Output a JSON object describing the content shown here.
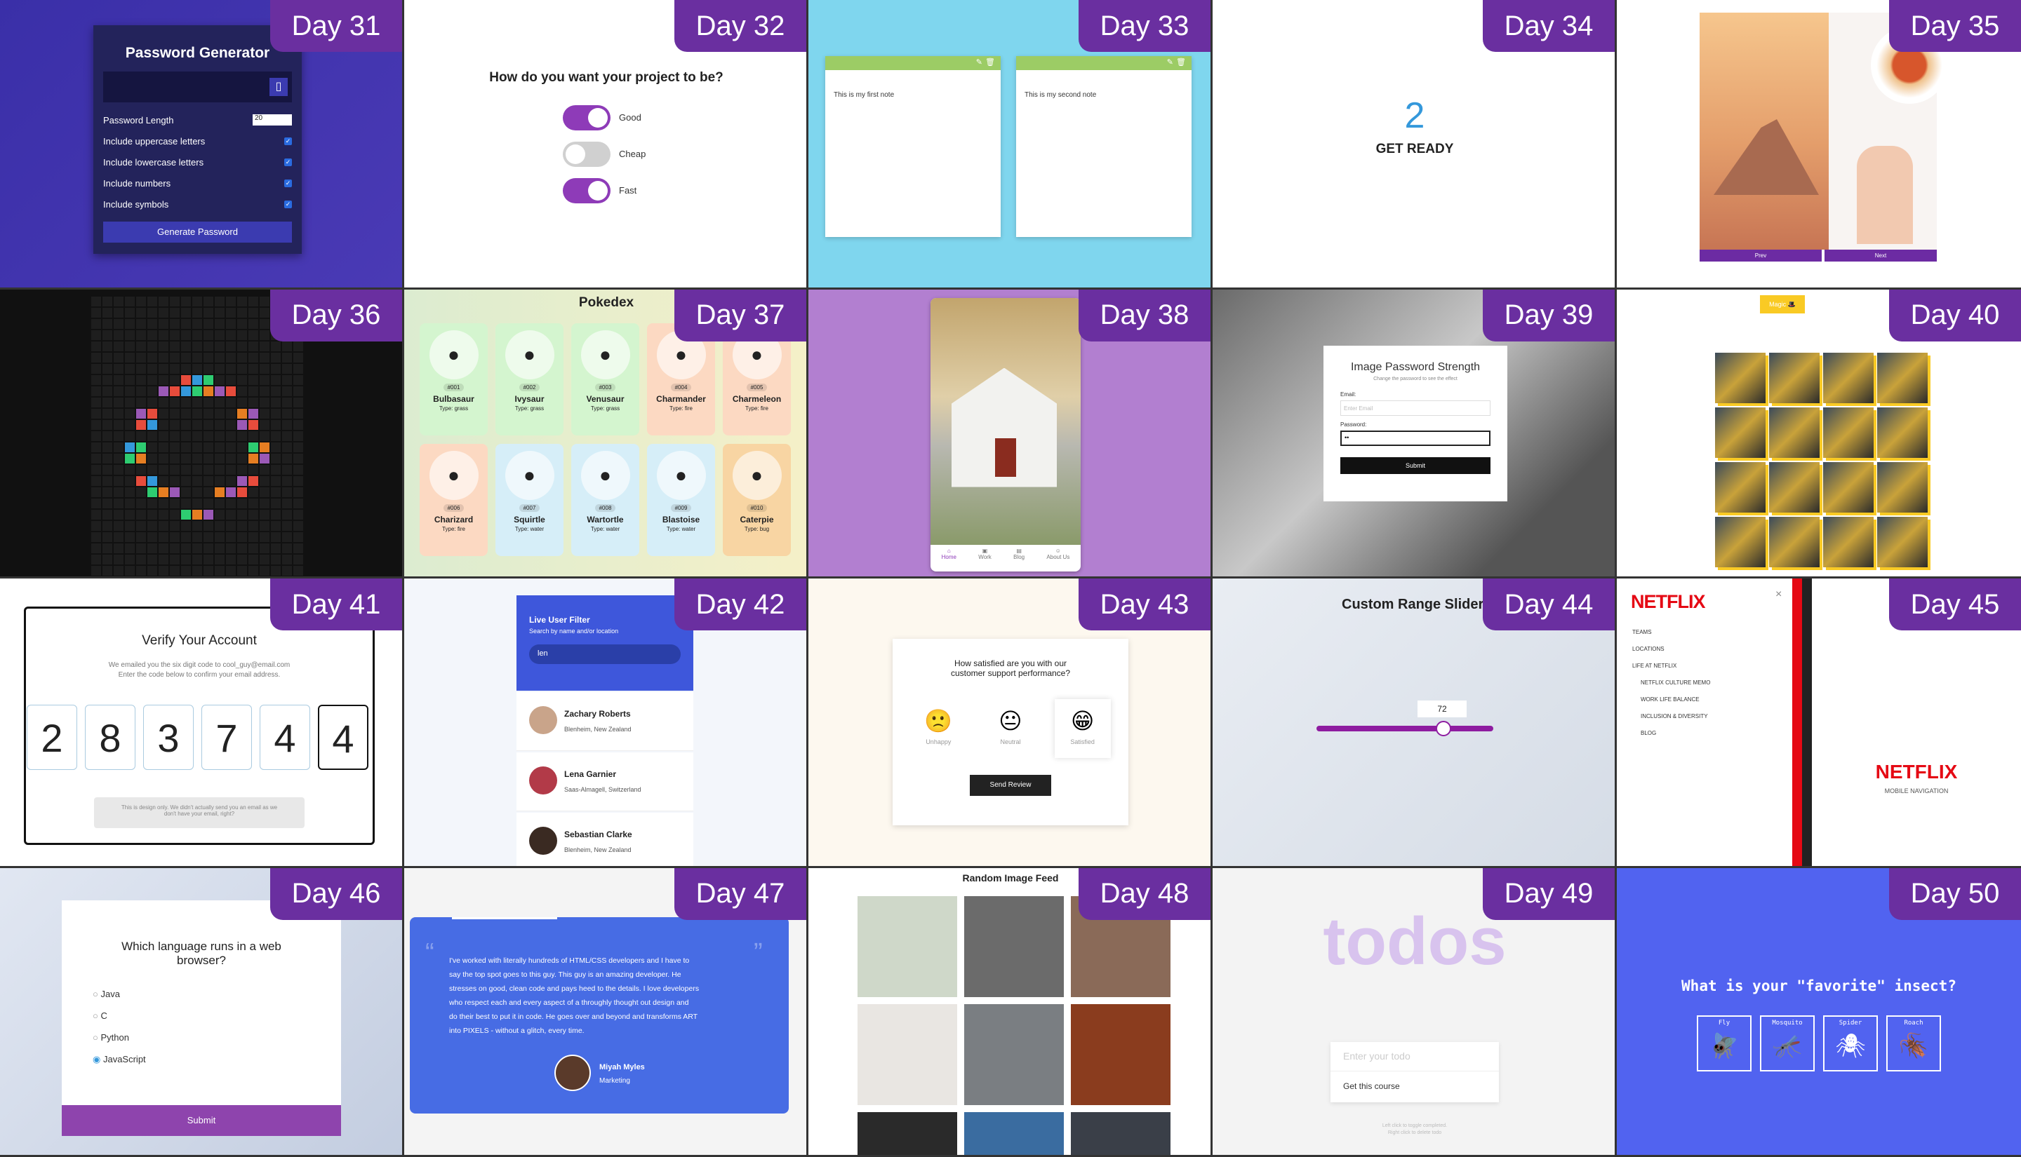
{
  "days": [
    "Day 31",
    "Day 32",
    "Day 33",
    "Day 34",
    "Day 35",
    "Day 36",
    "Day 37",
    "Day 38",
    "Day 39",
    "Day 40",
    "Day 41",
    "Day 42",
    "Day 43",
    "Day 44",
    "Day 45",
    "Day 46",
    "Day 47",
    "Day 48",
    "Day 49",
    "Day 50"
  ],
  "d31": {
    "title": "Password Generator",
    "length_label": "Password Length",
    "length_value": "20",
    "options": [
      "Include uppercase letters",
      "Include lowercase letters",
      "Include numbers",
      "Include symbols"
    ],
    "button": "Generate Password"
  },
  "d32": {
    "question": "How do you want your project to be?",
    "toggles": [
      "Good",
      "Cheap",
      "Fast"
    ]
  },
  "d33": {
    "notes": [
      "This is my first note",
      "This is my second note"
    ]
  },
  "d34": {
    "count": "2",
    "label": "GET READY"
  },
  "d35": {
    "prev": "Prev",
    "next": "Next"
  },
  "d37": {
    "title": "Pokedex",
    "pokemon": [
      {
        "num": "#001",
        "name": "Bulbasaur",
        "type": "Type: grass",
        "color": "#d4f5cf"
      },
      {
        "num": "#002",
        "name": "Ivysaur",
        "type": "Type: grass",
        "color": "#d4f5cf"
      },
      {
        "num": "#003",
        "name": "Venusaur",
        "type": "Type: grass",
        "color": "#d4f5cf"
      },
      {
        "num": "#004",
        "name": "Charmander",
        "type": "Type: fire",
        "color": "#fcd9c2"
      },
      {
        "num": "#005",
        "name": "Charmeleon",
        "type": "Type: fire",
        "color": "#fcd9c2"
      },
      {
        "num": "#006",
        "name": "Charizard",
        "type": "Type: fire",
        "color": "#fcd9c2"
      },
      {
        "num": "#007",
        "name": "Squirtle",
        "type": "Type: water",
        "color": "#d6eef8"
      },
      {
        "num": "#008",
        "name": "Wartortle",
        "type": "Type: water",
        "color": "#d6eef8"
      },
      {
        "num": "#009",
        "name": "Blastoise",
        "type": "Type: water",
        "color": "#d6eef8"
      },
      {
        "num": "#010",
        "name": "Caterpie",
        "type": "Type: bug",
        "color": "#f8d5a3"
      }
    ]
  },
  "d38": {
    "nav": [
      "Home",
      "Work",
      "Blog",
      "About Us"
    ]
  },
  "d39": {
    "title": "Image Password Strength",
    "subtitle": "Change the password to see the effect",
    "email_label": "Email:",
    "email_placeholder": "Enter Email",
    "password_label": "Password:",
    "password_value": "••",
    "button": "Submit"
  },
  "d40": {
    "button": "Magic 🎩"
  },
  "d41": {
    "title": "Verify Your Account",
    "text1": "We emailed you the six digit code to cool_guy@email.com",
    "text2": "Enter the code below to confirm your email address.",
    "digits": [
      "2",
      "8",
      "3",
      "7",
      "4",
      "4"
    ],
    "note1": "This is design only. We didn't actually send you an email as we",
    "note2": "don't have your email, right?"
  },
  "d42": {
    "title": "Live User Filter",
    "subtitle": "Search by name and/or location",
    "search": "len",
    "users": [
      {
        "name": "Zachary Roberts",
        "loc": "Blenheim, New Zealand"
      },
      {
        "name": "Lena Garnier",
        "loc": "Saas-Almagell, Switzerland"
      },
      {
        "name": "Sebastian Clarke",
        "loc": "Blenheim, New Zealand"
      }
    ]
  },
  "d43": {
    "q1": "How satisfied are you with our",
    "q2": "customer support performance?",
    "ratings": [
      "Unhappy",
      "Neutral",
      "Satisfied"
    ],
    "button": "Send Review"
  },
  "d44": {
    "title": "Custom Range Slider",
    "value": "72",
    "level": 0.72
  },
  "d45": {
    "logo": "NETFLIX",
    "items": [
      "TEAMS",
      "LOCATIONS",
      "LIFE AT NETFLIX"
    ],
    "subitems": [
      "NETFLIX CULTURE MEMO",
      "WORK LIFE BALANCE",
      "INCLUSION & DIVERSITY",
      "BLOG"
    ],
    "logo2": "NETFLIX",
    "caption": "MOBILE NAVIGATION",
    "close": "×"
  },
  "d46": {
    "question1": "Which language runs in a web",
    "question2": "browser?",
    "options": [
      "Java",
      "C",
      "Python",
      "JavaScript"
    ],
    "button": "Submit"
  },
  "d47": {
    "quote": [
      "I've worked with literally hundreds of HTML/CSS developers and I have to",
      "say the top spot goes to this guy. This guy is an amazing developer. He",
      "stresses on good, clean code and pays heed to the details. I love developers",
      "who respect each and every aspect of a throughly thought out design and",
      "do their best to put it in code. He goes over and beyond and transforms ART",
      "into PIXELS - without a glitch, every time."
    ],
    "name": "Miyah Myles",
    "role": "Marketing"
  },
  "d48": {
    "title": "Random Image Feed"
  },
  "d49": {
    "title": "todos",
    "placeholder": "Enter your todo",
    "item": "Get this course",
    "hint1": "Left click to toggle completed.",
    "hint2": "Right click to delete todo"
  },
  "d50": {
    "question": "What is your \"favorite\" insect?",
    "bugs": [
      "Fly",
      "Mosquito",
      "Spider",
      "Roach"
    ]
  },
  "colors": {
    "badge": "#6a2fa0",
    "toggle_on": "#8e3bb8",
    "netflix": "#e50914"
  }
}
